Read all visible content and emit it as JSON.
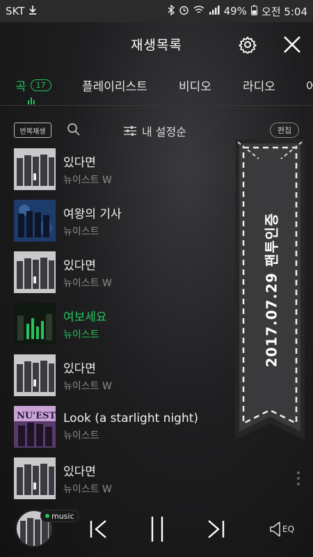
{
  "status_bar": {
    "carrier": "SKT",
    "battery": "49%",
    "time": "오전 5:04"
  },
  "header": {
    "title": "재생목록"
  },
  "tabs": [
    {
      "label": "곡",
      "count": "17"
    },
    {
      "label": "플레이리스트"
    },
    {
      "label": "비디오"
    },
    {
      "label": "라디오"
    },
    {
      "label": "어"
    }
  ],
  "toolbar": {
    "repeat_label": "반복재생",
    "sort_label": "내 설정순",
    "edit_label": "편집"
  },
  "songs": [
    {
      "title": "있다면",
      "artist": "뉴이스트 W",
      "active": false
    },
    {
      "title": "여왕의 기사",
      "artist": "뉴이스트",
      "active": false
    },
    {
      "title": "있다면",
      "artist": "뉴이스트 W",
      "active": false
    },
    {
      "title": "여보세요",
      "artist": "뉴이스트",
      "active": true
    },
    {
      "title": "있다면",
      "artist": "뉴이스트 W",
      "active": false
    },
    {
      "title": "Look (a starlight night)",
      "artist": "뉴이스트",
      "active": false
    },
    {
      "title": "있다면",
      "artist": "뉴이스트 W",
      "active": false
    }
  ],
  "banner": {
    "text": "2017.07.29 팬투인증"
  },
  "player": {
    "badge": "music",
    "eq_label": "EQ"
  },
  "colors": {
    "accent": "#25c55b",
    "background": "#141414"
  }
}
